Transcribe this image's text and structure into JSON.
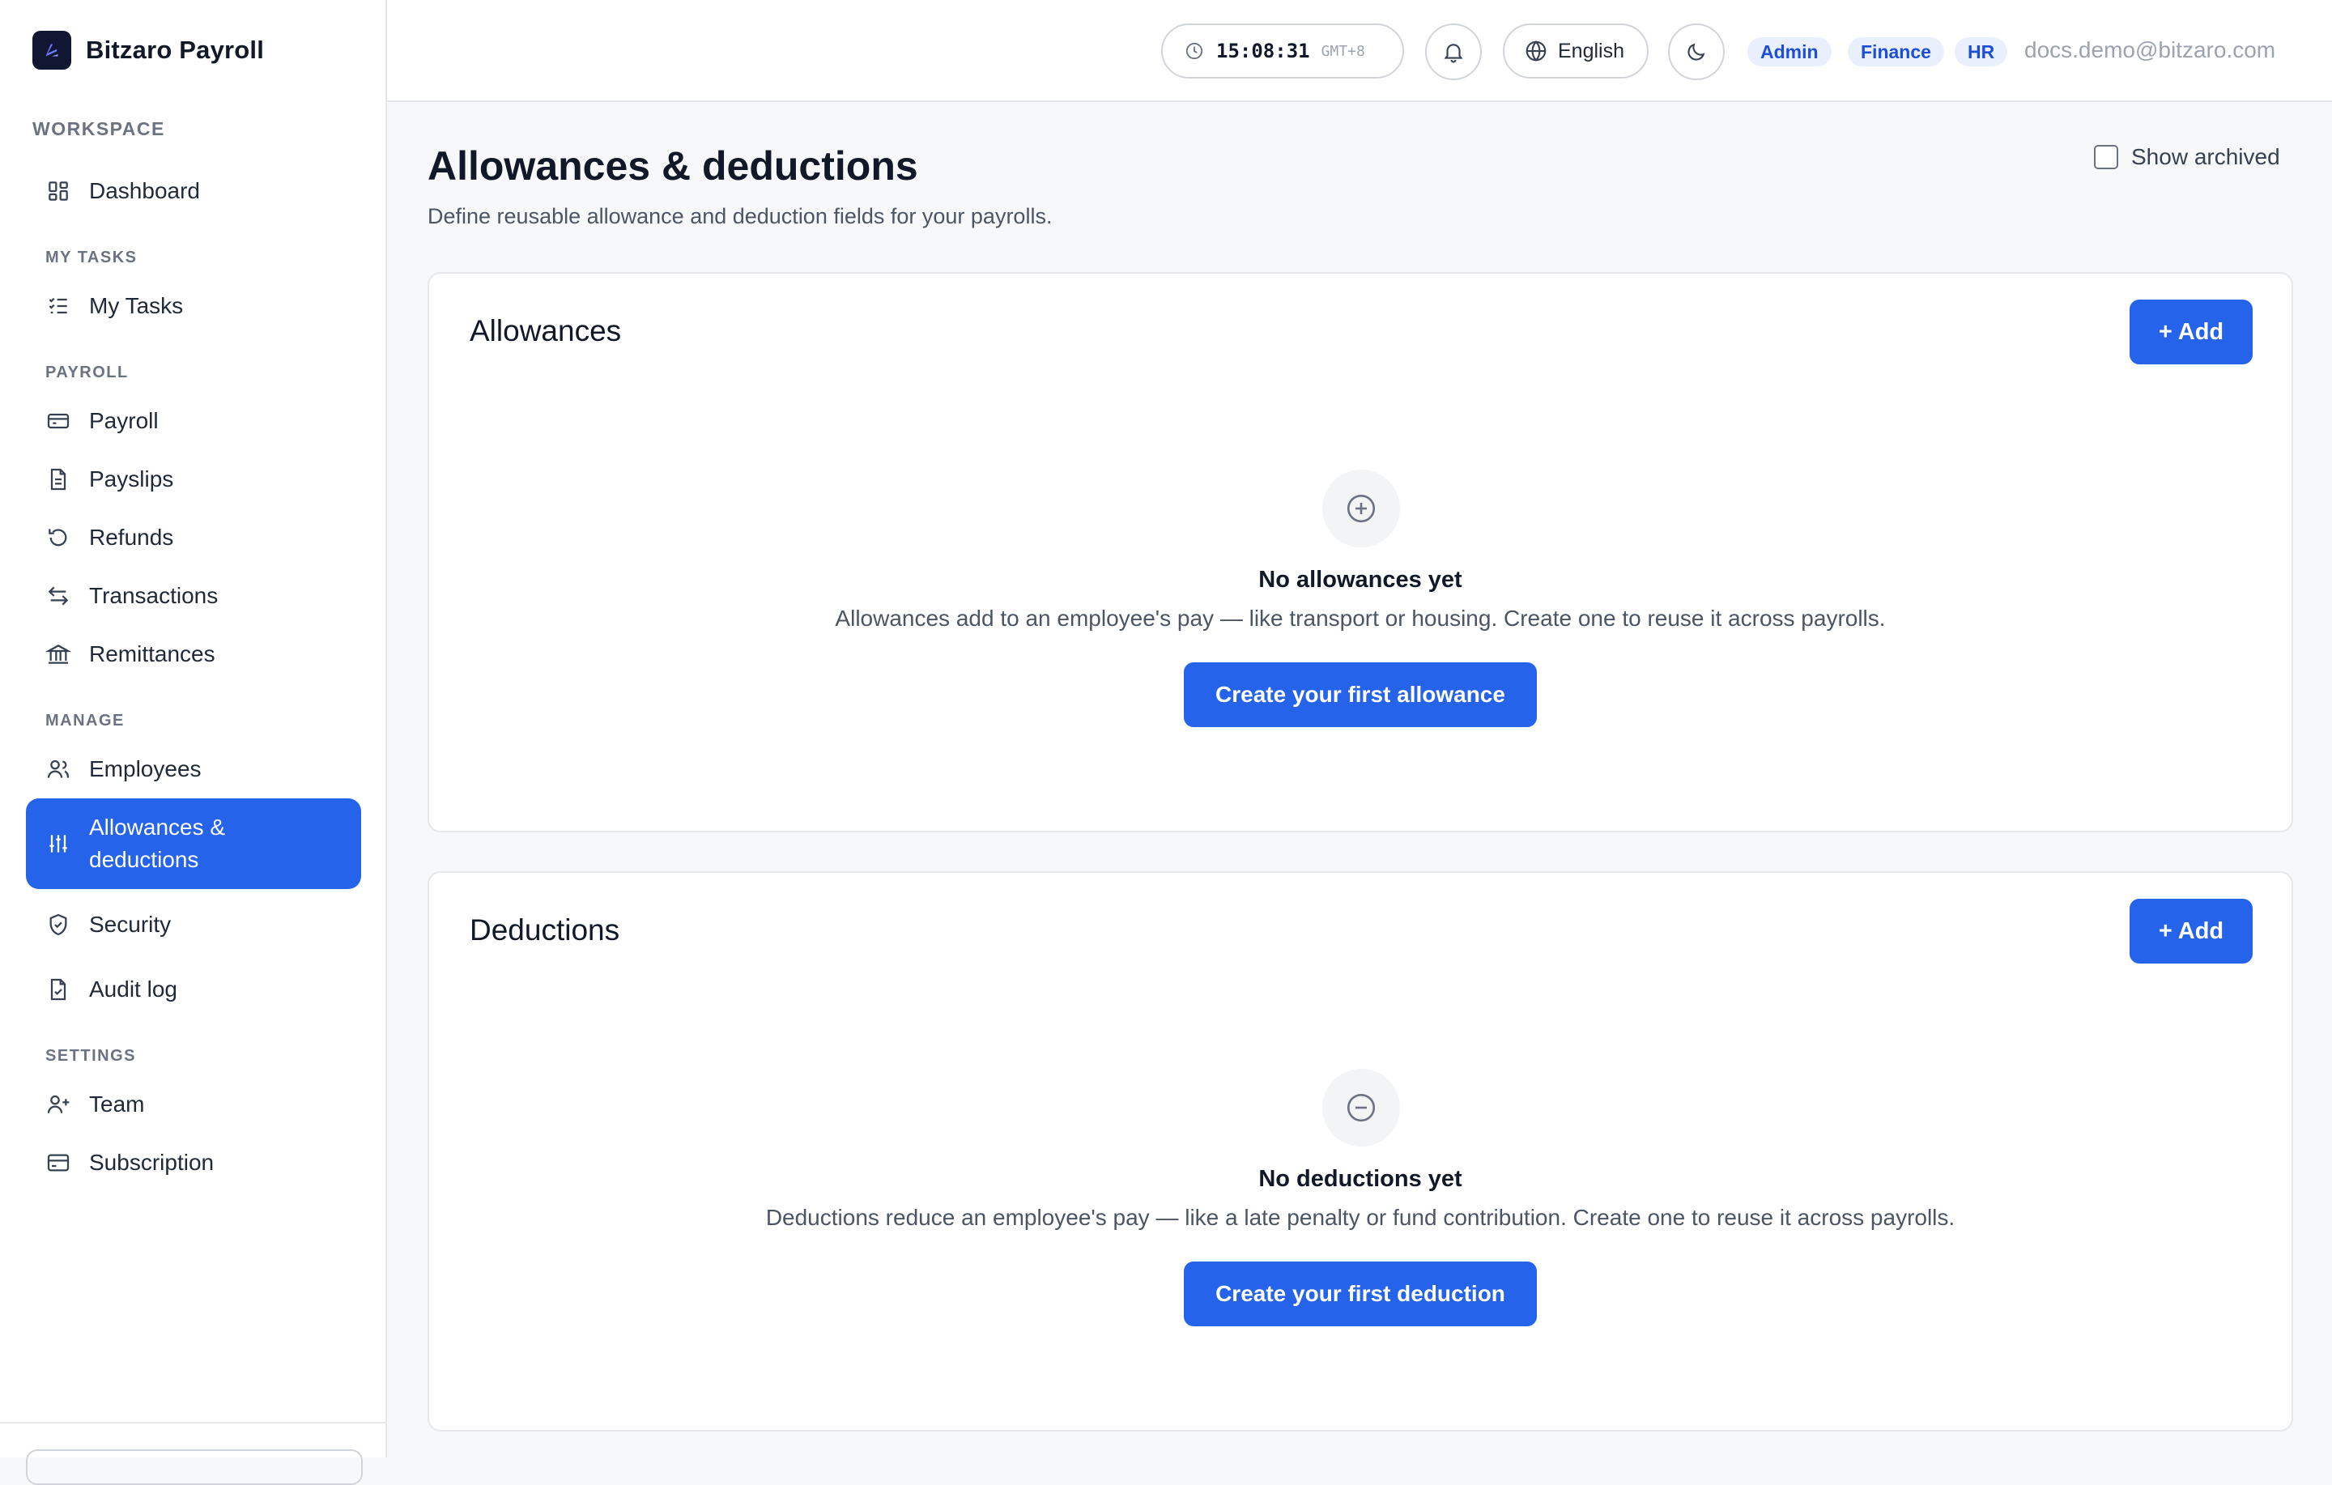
{
  "app": {
    "name": "Bitzaro Payroll"
  },
  "sidebar": {
    "workspace_title": "WORKSPACE",
    "sections": {
      "my_tasks": "MY TASKS",
      "payroll": "PAYROLL",
      "manage": "MANAGE",
      "settings": "SETTINGS"
    },
    "items": {
      "dashboard": "Dashboard",
      "my_tasks": "My Tasks",
      "payroll": "Payroll",
      "payslips": "Payslips",
      "refunds": "Refunds",
      "transactions": "Transactions",
      "remittances": "Remittances",
      "employees": "Employees",
      "allowances": "Allowances & deductions",
      "security": "Security",
      "audit_log": "Audit log",
      "team": "Team",
      "subscription": "Subscription"
    },
    "active_item": "allowances"
  },
  "topbar": {
    "time": "15:08:31",
    "timezone": "GMT+8",
    "language": "English",
    "roles": [
      "Admin",
      "Finance",
      "HR"
    ],
    "email": "docs.demo@bitzaro.com"
  },
  "main": {
    "title": "Allowances & deductions",
    "subtitle": "Define reusable allowance and deduction fields for your payrolls.",
    "show_archived_label": "Show archived",
    "show_archived_checked": false,
    "allowances": {
      "title": "Allowances",
      "add_label": "+ Add",
      "empty_title": "No allowances yet",
      "empty_desc": "Allowances add to an employee's pay — like transport or housing. Create one to reuse it across payrolls.",
      "cta_label": "Create your first allowance"
    },
    "deductions": {
      "title": "Deductions",
      "add_label": "+ Add",
      "empty_title": "No deductions yet",
      "empty_desc": "Deductions reduce an employee's pay — like a late penalty or fund contribution. Create one to reuse it across payrolls.",
      "cta_label": "Create your first deduction"
    }
  },
  "colors": {
    "accent": "#2563eb",
    "role_badge_bg": "#eaf0fb",
    "role_badge_text": "#1d4ed8"
  }
}
